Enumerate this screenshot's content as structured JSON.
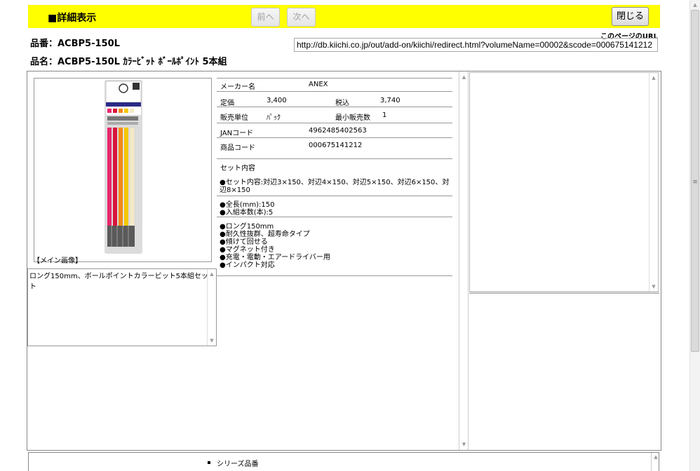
{
  "header": {
    "title": "■詳細表示",
    "prev_label": "前へ",
    "next_label": "次へ",
    "close_label": "閉じる"
  },
  "product": {
    "number_line": "品番：ACBP5-150L",
    "name_line": "品名：ACBP5-150L ｶﾗｰﾋﾞｯﾄ ﾎﾞｰﾙﾎﾟｲﾝﾄ 5本組"
  },
  "page_url": {
    "caption": "このページのURL",
    "value": "http://db.kiichi.co.jp/out/add-on/kiichi/redirect.html?volumeName=00002&scode=000675141212"
  },
  "image": {
    "caption": "【メイン画像】"
  },
  "description": "ロング150mm、ボールポイントカラービット5本組セット",
  "specs": {
    "maker_label": "メーカー名",
    "maker_value": "ANEX",
    "list_price_label": "定価",
    "list_price_value": "3,400",
    "tax_incl_label": "税込",
    "tax_incl_value": "3,740",
    "sales_unit_label": "販売単位",
    "sales_unit_value": "ﾊﾟｯｸ",
    "min_qty_label": "最小販売数",
    "min_qty_value": "1",
    "jan_label": "JANコード",
    "jan_value": "4962485402563",
    "product_code_label": "商品コード",
    "product_code_value": "000675141212",
    "set_contents_label": "セット内容",
    "set_contents_line1": "●セット内容:対辺3×150、対辺4×150、対辺5×150、対辺6×150、対",
    "set_contents_line2": "辺8×150",
    "length": "●全長(mm):150",
    "pieces": "●入組本数(本):5",
    "features": [
      "●ロング150mm",
      "●耐久性抜群、超寿命タイプ",
      "●傾けて回せる",
      "●マグネット付き",
      "●充電・電動・エアードライバー用",
      "●インパクト対応"
    ]
  },
  "series": {
    "label": "シリーズ品番"
  },
  "colors": {
    "header_bg": "#ffff00",
    "bit_colors": [
      "#e8266a",
      "#d8153a",
      "#f28a1a",
      "#f5c800",
      "#f3e9c8"
    ]
  }
}
